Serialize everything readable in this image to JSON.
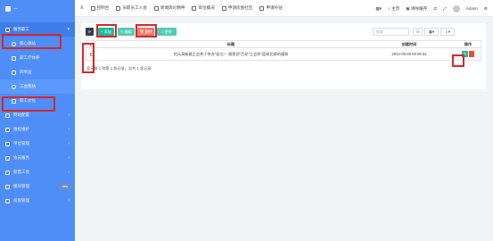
{
  "brand": {
    "text": "—"
  },
  "sidebar": {
    "items": [
      {
        "label": "服务职工",
        "icon": "users-icon",
        "active_parent": true
      },
      {
        "label": "暖心驿站",
        "icon": "circle-icon",
        "sub": true
      },
      {
        "label": "职工疗休养",
        "icon": "square-icon",
        "sub": true
      },
      {
        "label": "四季送",
        "icon": "gift-icon",
        "sub": true
      },
      {
        "label": "工会帮扶",
        "icon": "circle-icon",
        "sub": true,
        "active": true
      },
      {
        "label": "职工文化",
        "icon": "square-icon",
        "sub": true
      },
      {
        "label": "网站配置",
        "icon": "gear-icon"
      },
      {
        "label": "维权维护",
        "icon": "shield-icon"
      },
      {
        "label": "单位管理",
        "icon": "building-icon"
      },
      {
        "label": "会员服务",
        "icon": "user-icon"
      },
      {
        "label": "智慧工会",
        "icon": "chip-icon"
      },
      {
        "label": "模块管理",
        "icon": "grid-icon",
        "badge": "new"
      },
      {
        "label": "权限管理",
        "icon": "lock-icon"
      }
    ]
  },
  "topbar": {
    "items": [
      "控制台",
      "员职员工入会",
      "新闻舆论精神",
      "单位概况",
      "申请房屋社区",
      "申请补贴"
    ],
    "right": [
      "主页",
      "清除缓存",
      "Admin"
    ]
  },
  "toolbar": {
    "refresh": "⟳",
    "add": "+ 添加",
    "edit": "✎ 编辑",
    "delete": "🗑 删除",
    "more": "≡ 更多",
    "search_placeholder": "搜索"
  },
  "table": {
    "headers": {
      "title": "标题",
      "create_time": "创建时间",
      "actions": "操作"
    },
    "rows": [
      {
        "title": "恒元高新路工会关于举办\"迎七一 感恩党\"百花\"工会杯\"篮球比赛的通知",
        "create_time": "2022-06-09 09:06:02"
      }
    ],
    "footer": "显示第 1 到第 1 条记录，总共 1 条记录"
  },
  "colors": {
    "sidebar": "#4f8ef7",
    "success": "#18bc9c",
    "danger": "#e74c3c",
    "highlight": "#d8262b"
  }
}
